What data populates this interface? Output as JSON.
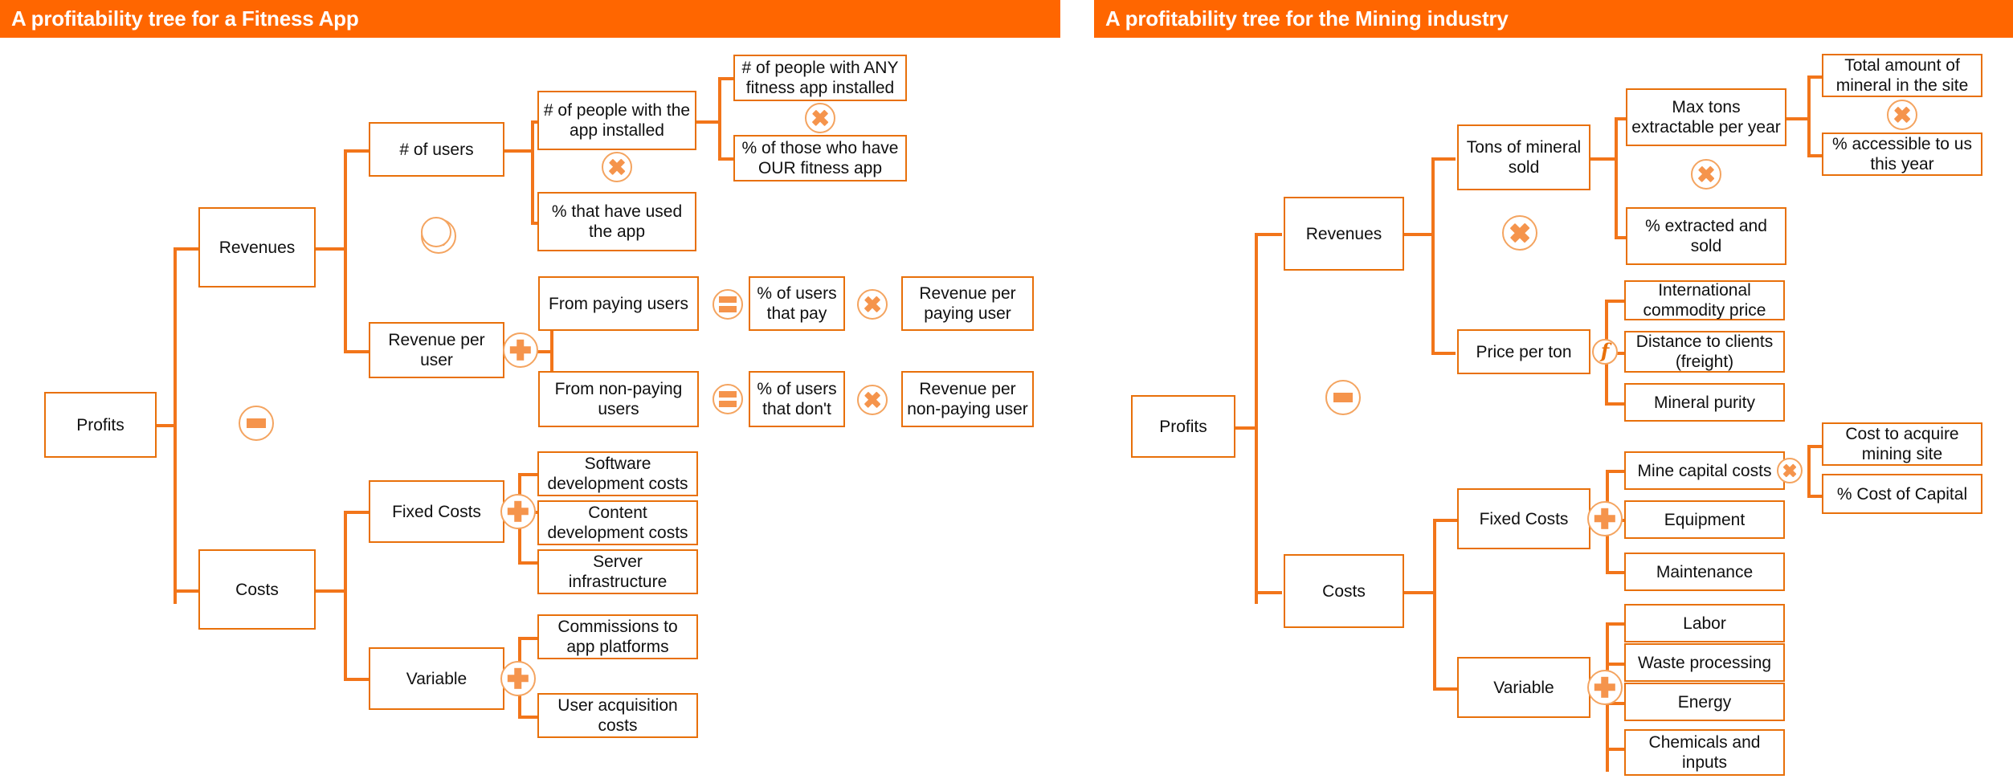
{
  "colors": {
    "banner_bg": "#FF6600",
    "banner_text": "#FFFFFF",
    "node_border": "#E8700A",
    "connector": "#F2751A",
    "operator_fill": "#F5944C",
    "operator_ring": "#F4A460",
    "node_text": "#101010",
    "page_bg": "#FFFFFF"
  },
  "trees": [
    {
      "id": "fitness-app",
      "title": "A profitability tree for a Fitness App",
      "root": {
        "label": "Profits"
      },
      "root_operator": {
        "type": "minus",
        "symbol": "−"
      },
      "branches": [
        {
          "label": "Revenues",
          "operator": {
            "type": "multiply",
            "symbol": "×"
          },
          "children": [
            {
              "label": "# of users",
              "operator": {
                "type": "multiply",
                "symbol": "×"
              },
              "children": [
                {
                  "label": "# of people with the app installed",
                  "operator": {
                    "type": "multiply",
                    "symbol": "×"
                  },
                  "children": [
                    {
                      "label": "# of people with ANY fitness app installed"
                    },
                    {
                      "label": "% of those who have OUR fitness app"
                    }
                  ]
                },
                {
                  "label": "% that have used the app"
                }
              ]
            },
            {
              "label": "Revenue per user",
              "operator": {
                "type": "plus",
                "symbol": "+"
              },
              "children": [
                {
                  "label": "From paying users",
                  "operator": {
                    "type": "equals",
                    "symbol": "="
                  },
                  "children": [
                    {
                      "label": "% of users that pay"
                    },
                    {
                      "label": "Revenue per paying user"
                    }
                  ],
                  "child_operator": {
                    "type": "multiply",
                    "symbol": "×"
                  }
                },
                {
                  "label": "From non-paying users",
                  "operator": {
                    "type": "equals",
                    "symbol": "="
                  },
                  "children": [
                    {
                      "label": "% of users that don't"
                    },
                    {
                      "label": "Revenue per non-paying user"
                    }
                  ],
                  "child_operator": {
                    "type": "multiply",
                    "symbol": "×"
                  }
                }
              ]
            }
          ]
        },
        {
          "label": "Costs",
          "children": [
            {
              "label": "Fixed Costs",
              "operator": {
                "type": "plus",
                "symbol": "+"
              },
              "children": [
                {
                  "label": "Software development costs"
                },
                {
                  "label": "Content development costs"
                },
                {
                  "label": "Server infrastructure"
                }
              ]
            },
            {
              "label": "Variable",
              "operator": {
                "type": "plus",
                "symbol": "+"
              },
              "children": [
                {
                  "label": "Commissions to app platforms"
                },
                {
                  "label": "User acquisition costs"
                }
              ]
            }
          ]
        }
      ]
    },
    {
      "id": "mining-industry",
      "title": "A profitability tree for the Mining industry",
      "root": {
        "label": "Profits"
      },
      "root_operator": {
        "type": "minus",
        "symbol": "−"
      },
      "branches": [
        {
          "label": "Revenues",
          "operator": {
            "type": "multiply",
            "symbol": "×"
          },
          "children": [
            {
              "label": "Tons of mineral sold",
              "operator": {
                "type": "multiply",
                "symbol": "×"
              },
              "children": [
                {
                  "label": "Max tons extractable per year",
                  "operator": {
                    "type": "multiply",
                    "symbol": "×"
                  },
                  "children": [
                    {
                      "label": "Total amount of mineral in the site"
                    },
                    {
                      "label": "% accessible to us this year"
                    }
                  ]
                },
                {
                  "label": "% extracted and sold"
                }
              ]
            },
            {
              "label": "Price per ton",
              "operator": {
                "type": "function",
                "symbol": "f"
              },
              "children": [
                {
                  "label": "International commodity price"
                },
                {
                  "label": "Distance to clients (freight)"
                },
                {
                  "label": "Mineral purity"
                }
              ]
            }
          ]
        },
        {
          "label": "Costs",
          "children": [
            {
              "label": "Fixed Costs",
              "operator": {
                "type": "plus",
                "symbol": "+"
              },
              "children": [
                {
                  "label": "Mine capital costs",
                  "operator": {
                    "type": "multiply",
                    "symbol": "×"
                  },
                  "children": [
                    {
                      "label": "Cost to acquire mining site"
                    },
                    {
                      "label": "% Cost of Capital"
                    }
                  ]
                },
                {
                  "label": "Equipment"
                },
                {
                  "label": "Maintenance"
                }
              ]
            },
            {
              "label": "Variable",
              "operator": {
                "type": "plus",
                "symbol": "+"
              },
              "children": [
                {
                  "label": "Labor"
                },
                {
                  "label": "Waste processing"
                },
                {
                  "label": "Energy"
                },
                {
                  "label": "Chemicals and inputs"
                }
              ]
            }
          ]
        }
      ]
    }
  ]
}
